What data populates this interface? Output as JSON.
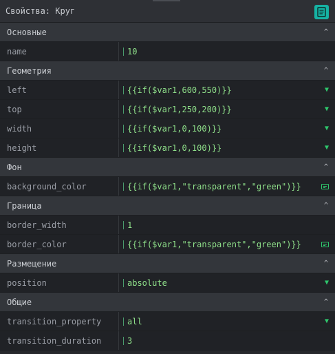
{
  "panel": {
    "title": "Свойства: Круг",
    "title_icon": "document-icon"
  },
  "sections": [
    {
      "label": "Основные",
      "rows": [
        {
          "key": "name",
          "value": "10",
          "control": "none"
        }
      ]
    },
    {
      "label": "Геометрия",
      "rows": [
        {
          "key": "left",
          "value": "{{if($var1,600,550)}}",
          "control": "dropdown"
        },
        {
          "key": "top",
          "value": "{{if($var1,250,200)}}",
          "control": "dropdown"
        },
        {
          "key": "width",
          "value": "{{if($var1,0,100)}}",
          "control": "dropdown"
        },
        {
          "key": "height",
          "value": "{{if($var1,0,100)}}",
          "control": "dropdown"
        }
      ]
    },
    {
      "label": "Фон",
      "rows": [
        {
          "key": "background_color",
          "value": "{{if($var1,\"transparent\",\"green\")}}",
          "control": "text-edit"
        }
      ]
    },
    {
      "label": "Граница",
      "rows": [
        {
          "key": "border_width",
          "value": "1",
          "control": "none"
        },
        {
          "key": "border_color",
          "value": "{{if($var1,\"transparent\",\"green\")}}",
          "control": "text-edit"
        }
      ]
    },
    {
      "label": "Размещение",
      "rows": [
        {
          "key": "position",
          "value": "absolute",
          "control": "dropdown"
        }
      ]
    },
    {
      "label": "Общие",
      "rows": [
        {
          "key": "transition_property",
          "value": "all",
          "control": "dropdown"
        },
        {
          "key": "transition_duration",
          "value": "3",
          "control": "none"
        }
      ]
    }
  ],
  "colors": {
    "accent": "#16b3a4",
    "value_text": "#8fe08a",
    "control_green": "#2ec76c"
  }
}
